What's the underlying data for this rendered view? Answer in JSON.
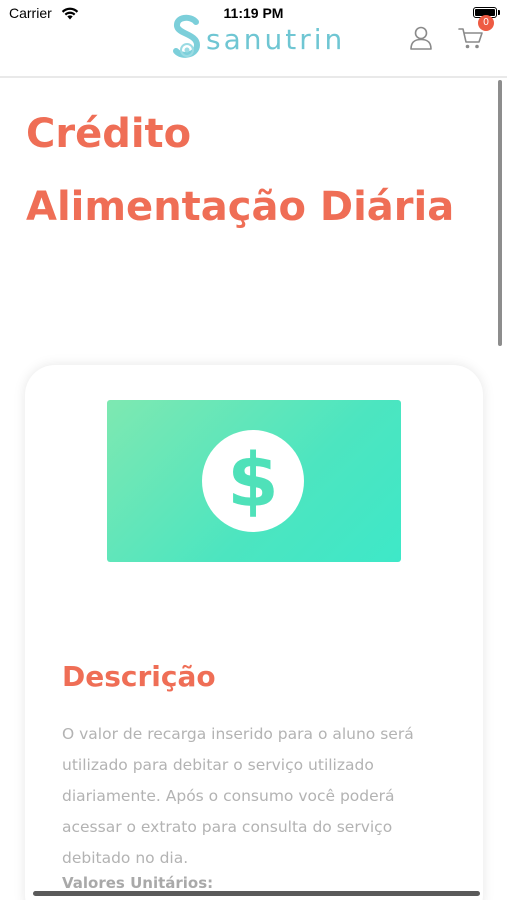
{
  "status_bar": {
    "carrier": "Carrier",
    "time": "11:19 PM",
    "icons": [
      "wifi-icon",
      "battery-icon"
    ]
  },
  "header": {
    "logo_text": "sanutrin",
    "logo_icon": "sanutrin-s-logo-icon",
    "user_icon": "user-icon",
    "cart_icon": "shopping-cart-icon",
    "cart_count": "0"
  },
  "page": {
    "title": "Crédito Alimentação Diária"
  },
  "card": {
    "image_icon": "dollar-circle-icon",
    "dollar_symbol": "$",
    "section_title": "Descrição",
    "description": "O valor de recarga inserido para o aluno será utilizado para debitar o serviço utilizado diariamente. Após o consumo você poderá acessar o extrato para consulta do serviço debitado no dia.",
    "unit_values_label": "Valores Unitários:"
  },
  "colors": {
    "accent": "#ef6e56",
    "brand": "#6fc6d3",
    "badge": "#ee5b43",
    "banner_start": "#7ee8b1",
    "banner_end": "#3ee8c8",
    "body_text": "#b3b3b3"
  }
}
